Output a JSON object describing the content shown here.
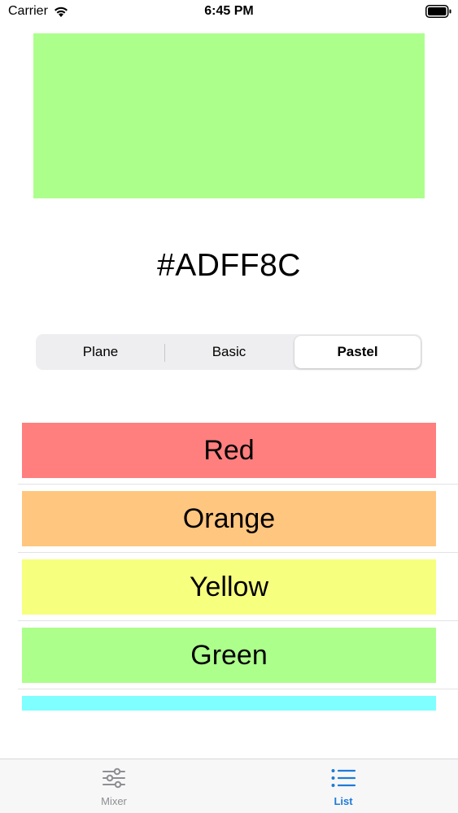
{
  "status_bar": {
    "carrier": "Carrier",
    "time": "6:45 PM"
  },
  "preview": {
    "color": "#ADFF8C",
    "hex_label": "#ADFF8C"
  },
  "segmented_control": {
    "segments": [
      "Plane",
      "Basic",
      "Pastel"
    ],
    "selected": "Pastel"
  },
  "color_list": {
    "items": [
      {
        "label": "Red",
        "color": "#FF7F7F"
      },
      {
        "label": "Orange",
        "color": "#FFC67F"
      },
      {
        "label": "Yellow",
        "color": "#F7FF7F"
      },
      {
        "label": "Green",
        "color": "#ADFF8C"
      },
      {
        "label": "",
        "color": "#7FFFFF"
      }
    ]
  },
  "tab_bar": {
    "tabs": [
      {
        "label": "Mixer",
        "icon": "sliders-icon",
        "active": false
      },
      {
        "label": "List",
        "icon": "list-icon",
        "active": true
      }
    ],
    "active_color": "#1E7BD6",
    "inactive_color": "#8E8E93"
  }
}
